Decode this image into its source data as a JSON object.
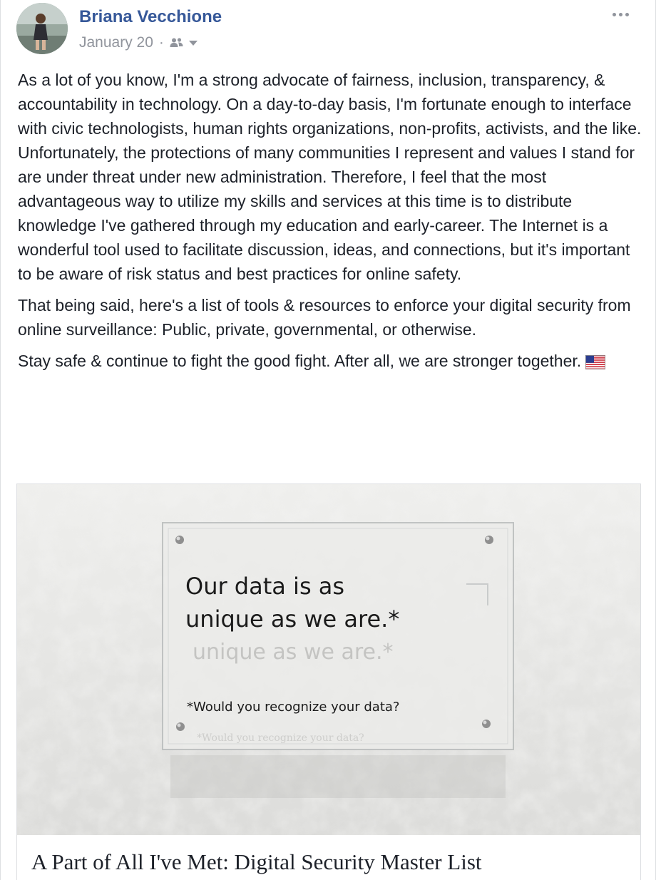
{
  "post": {
    "author": "Briana Vecchione",
    "date": "January 20",
    "separator": "·",
    "audience_icon": "friends-icon",
    "more_icon": "more-icon",
    "paragraphs": [
      "As a lot of you know, I'm a strong advocate of fairness, inclusion, transparency, & accountability in technology. On a day-to-day basis, I'm fortunate enough to interface with civic technologists, human rights organizations, non-profits, activists, and the like. Unfortunately, the protections of many communities I represent and values I stand for are under threat under new administration. Therefore, I feel that the most advantageous way to utilize my skills and services at this time is to distribute knowledge I've gathered through my education and early-career. The Internet is a wonderful tool used to facilitate discussion, ideas, and connections, but it's important to be aware of risk status and best practices for online safety.",
      "That being said, here's a list of tools & resources to enforce your digital security from online surveillance: Public, private, governmental, or otherwise.",
      "Stay safe & continue to fight the good fight. After all, we are stronger together."
    ],
    "flag_icon": "us-flag-icon"
  },
  "attachment": {
    "sign_line1": "Our data is as",
    "sign_line2": "unique as we are.*",
    "sign_reflection": "unique as we are.*",
    "sign_footnote": "*Would you recognize your data?",
    "sign_footnote_reflection": "*Would you recognize your data?",
    "title": "A Part of All I've Met: Digital Security Master List"
  },
  "colors": {
    "link": "#365899",
    "meta": "#90949c",
    "text": "#1d2129",
    "border": "#dddfe2"
  }
}
